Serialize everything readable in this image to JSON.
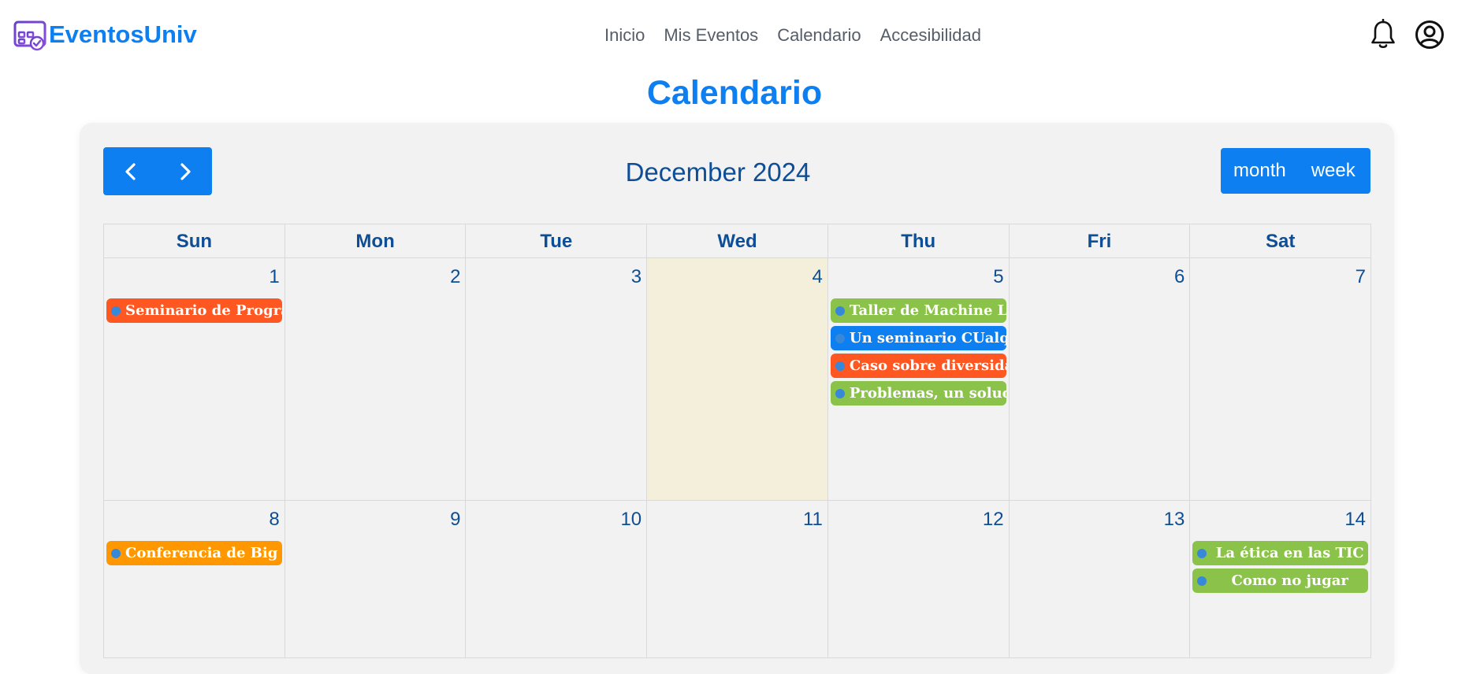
{
  "brand": {
    "name": "EventosUniv",
    "icon": "calendar-check-icon"
  },
  "nav": {
    "items": [
      "Inicio",
      "Mis Eventos",
      "Calendario",
      "Accesibilidad"
    ]
  },
  "header_icons": {
    "notifications": "bell-icon",
    "account": "user-circle-icon"
  },
  "page": {
    "title": "Calendario"
  },
  "calendar": {
    "title": "December 2024",
    "prev_icon": "chevron-left-icon",
    "next_icon": "chevron-right-icon",
    "views": [
      "month",
      "week"
    ],
    "weekdays": [
      "Sun",
      "Mon",
      "Tue",
      "Wed",
      "Thu",
      "Fri",
      "Sat"
    ],
    "today": "4",
    "weeks": [
      {
        "days": [
          {
            "num": "1",
            "events": [
              {
                "title": "Seminario de Programación",
                "color": "#ff5722"
              }
            ]
          },
          {
            "num": "2",
            "events": []
          },
          {
            "num": "3",
            "events": []
          },
          {
            "num": "4",
            "events": []
          },
          {
            "num": "5",
            "events": [
              {
                "title": "Taller de Machine Learning",
                "color": "#8bc34a"
              },
              {
                "title": "Un seminario CUalquiera",
                "color": "#0d7ff0"
              },
              {
                "title": "Caso sobre diversidad",
                "color": "#ff5722"
              },
              {
                "title": "Problemas, un solucionario",
                "color": "#8bc34a"
              }
            ]
          },
          {
            "num": "6",
            "events": []
          },
          {
            "num": "7",
            "events": []
          }
        ]
      },
      {
        "days": [
          {
            "num": "8",
            "events": [
              {
                "title": "Conferencia de Big Data",
                "color": "#ff9800"
              }
            ]
          },
          {
            "num": "9",
            "events": []
          },
          {
            "num": "10",
            "events": []
          },
          {
            "num": "11",
            "events": []
          },
          {
            "num": "12",
            "events": []
          },
          {
            "num": "13",
            "events": []
          },
          {
            "num": "14",
            "events": [
              {
                "title": "La ética en las TIC",
                "color": "#8bc34a"
              },
              {
                "title": "Como no jugar",
                "color": "#8bc34a"
              }
            ]
          }
        ]
      }
    ],
    "event_dot_color": "#3788d8",
    "today_color": "#f4efda"
  },
  "colors": {
    "accent": "#0d7ff0",
    "calendar_text": "#0e4e96",
    "nav_text": "#555e68"
  }
}
